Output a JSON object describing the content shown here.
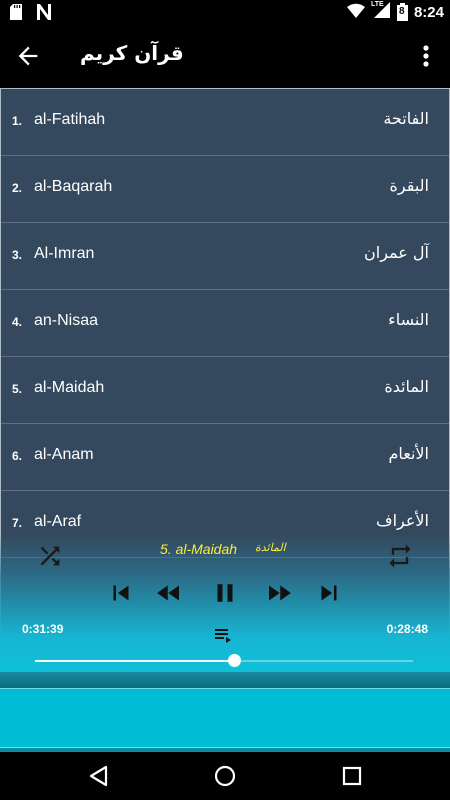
{
  "status_bar": {
    "time": "8:24",
    "network_label": "LTE",
    "battery_level": "8",
    "icons": [
      "sd-card-icon",
      "n-notification-icon",
      "wifi-icon",
      "signal-icon",
      "battery-icon"
    ]
  },
  "app_bar": {
    "title": "قرآن كريم",
    "back_icon": "arrow-back-icon",
    "menu_icon": "more-vert-icon"
  },
  "surahs": [
    {
      "number": "1.",
      "name": "al-Fatihah",
      "arabic": "الفاتحة"
    },
    {
      "number": "2.",
      "name": "al-Baqarah",
      "arabic": "البقرة"
    },
    {
      "number": "3.",
      "name": "Al-Imran",
      "arabic": "آل عمران"
    },
    {
      "number": "4.",
      "name": "an-Nisaa",
      "arabic": "النساء"
    },
    {
      "number": "5.",
      "name": "al-Maidah",
      "arabic": "المائدة"
    },
    {
      "number": "6.",
      "name": "al-Anam",
      "arabic": "الأنعام"
    },
    {
      "number": "7.",
      "name": "al-Araf",
      "arabic": "الأعراف"
    }
  ],
  "player": {
    "now_playing": "5. al-Maidah",
    "now_playing_arabic": "المائدة",
    "time_elapsed": "0:31:39",
    "time_remaining": "0:28:48",
    "progress_fraction": 0.527,
    "state": "playing",
    "accent_color": "#ffeb3b",
    "controls": [
      "shuffle-icon",
      "skip-previous-icon",
      "rewind-icon",
      "pause-icon",
      "fast-forward-icon",
      "skip-next-icon",
      "repeat-icon",
      "playlist-icon"
    ]
  },
  "colors": {
    "list_background": "#34495e",
    "player_gradient_end": "#10c0d8",
    "banner": "#00bcd4"
  },
  "nav_bar": {
    "icons": [
      "nav-back-icon",
      "nav-home-icon",
      "nav-recents-icon"
    ]
  }
}
